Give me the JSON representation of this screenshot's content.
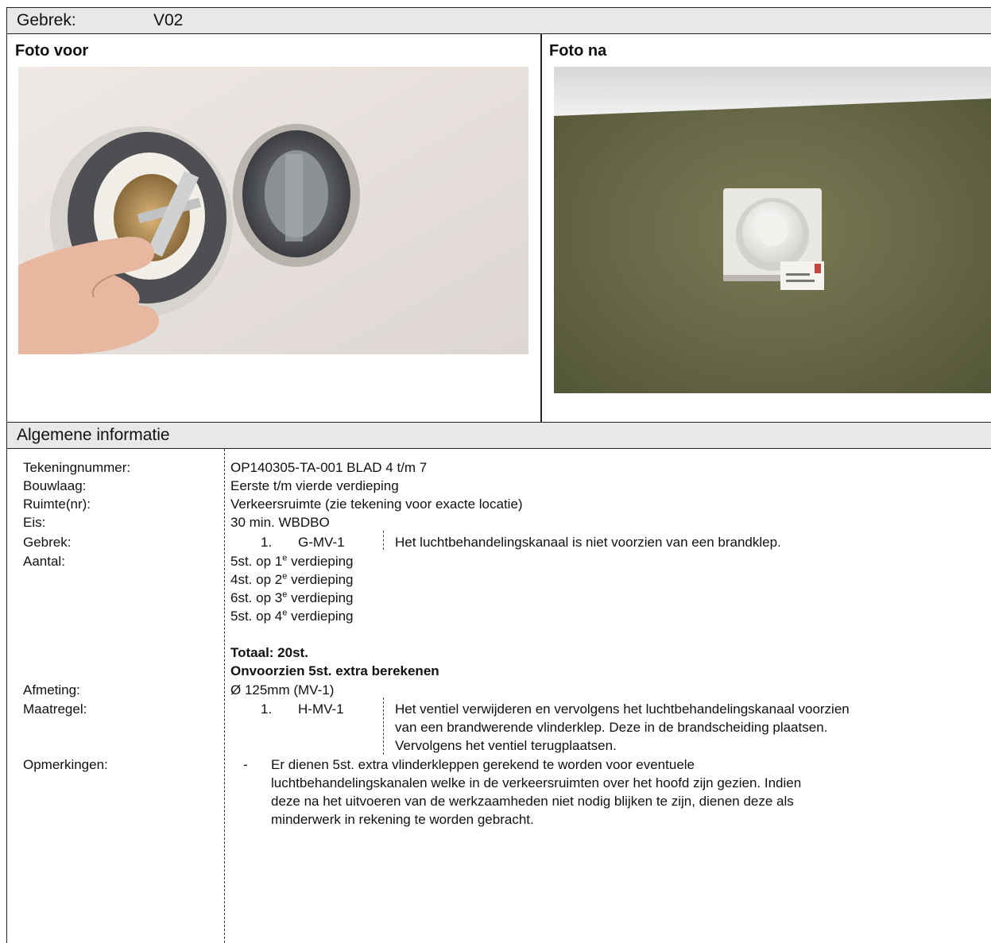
{
  "header": {
    "label": "Gebrek:",
    "value": "V02"
  },
  "photos": {
    "before_label": "Foto voor",
    "after_label": "Foto na"
  },
  "section_title": "Algemene informatie",
  "info": {
    "tekeningnummer_label": "Tekeningnummer:",
    "tekeningnummer": "OP140305-TA-001 BLAD 4 t/m 7",
    "bouwlaag_label": "Bouwlaag:",
    "bouwlaag": "Eerste t/m vierde verdieping",
    "ruimte_label": "Ruimte(nr):",
    "ruimte": "Verkeersruimte (zie tekening voor exacte locatie)",
    "eis_label": "Eis:",
    "eis": "30 min. WBDBO",
    "gebrek_label": "Gebrek:",
    "gebrek_num": "1.",
    "gebrek_code": "G-MV-1",
    "gebrek_text": "Het luchtbehandelingskanaal is niet voorzien van een brandklep.",
    "aantal_label": "Aantal:",
    "aantal": [
      {
        "pre": "5st. op 1",
        "sup": "e",
        "post": " verdieping"
      },
      {
        "pre": "4st. op 2",
        "sup": "e",
        "post": " verdieping"
      },
      {
        "pre": "6st. op 3",
        "sup": "e",
        "post": " verdieping"
      },
      {
        "pre": "5st. op 4",
        "sup": "e",
        "post": " verdieping"
      }
    ],
    "totaal": "Totaal: 20st.",
    "onvoorzien": "Onvoorzien 5st. extra berekenen",
    "afmeting_label": "Afmeting:",
    "afmeting": "Ø 125mm (MV-1)",
    "maatregel_label": "Maatregel:",
    "maatregel_num": "1.",
    "maatregel_code": "H-MV-1",
    "maatregel_lines": [
      "Het ventiel verwijderen en vervolgens het luchtbehandelingskanaal voorzien",
      "van een brandwerende vlinderklep. Deze in de brandscheiding plaatsen.",
      "Vervolgens het ventiel terugplaatsen."
    ],
    "opmerkingen_label": "Opmerkingen:",
    "opmerkingen_bullet": "-",
    "opmerkingen_lines": [
      "Er dienen 5st. extra vlinderkleppen gerekend te worden voor eventuele",
      "luchtbehandelingskanalen welke in de verkeersruimten over het hoofd zijn gezien. Indien",
      "deze na het uitvoeren van de werkzaamheden niet nodig blijken te zijn, dienen deze als",
      "minderwerk in rekening te worden gebracht."
    ]
  }
}
